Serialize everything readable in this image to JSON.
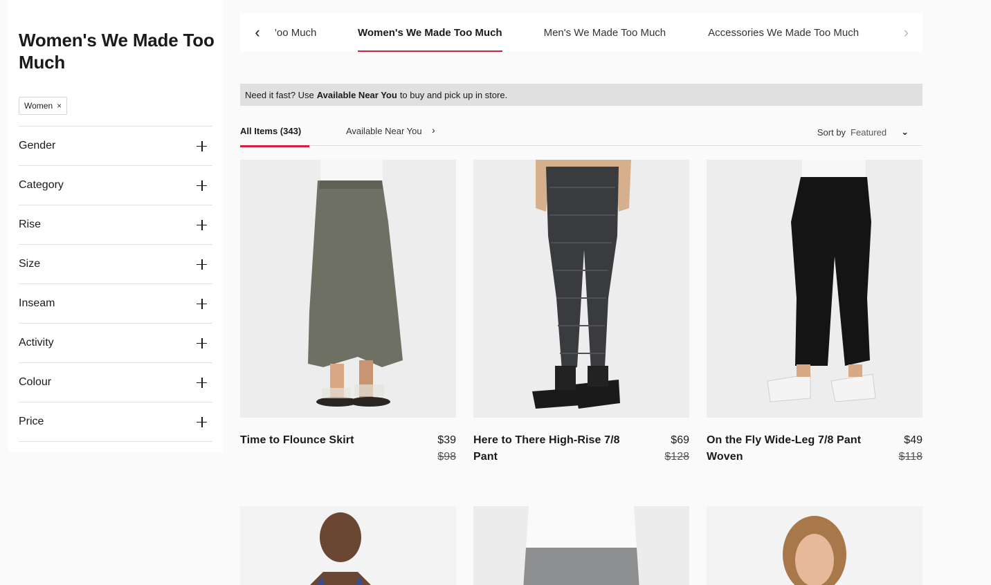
{
  "sidebar": {
    "title": "Women's We Made Too Much",
    "chip": {
      "label": "Women",
      "remove": "×"
    },
    "filters": [
      "Gender",
      "Category",
      "Rise",
      "Size",
      "Inseam",
      "Activity",
      "Colour",
      "Price"
    ]
  },
  "category_tabs": {
    "prev": "‹",
    "next": "›",
    "items": [
      {
        "label": "'oo Much"
      },
      {
        "label": "Women's We Made Too Much",
        "active": true
      },
      {
        "label": "Men's We Made Too Much"
      },
      {
        "label": "Accessories We Made Too Much"
      }
    ]
  },
  "notice": {
    "prefix": "Need it fast? Use",
    "bold": "Available Near You",
    "suffix": "to buy and pick up in store."
  },
  "subtabs": {
    "all": "All Items (343)",
    "near": "Available Near You",
    "sort_label": "Sort by",
    "sort_value": "Featured"
  },
  "products": [
    {
      "name": "Time to Flounce Skirt",
      "price": "$39",
      "was": "$98",
      "image": "olive-skirt-sandals"
    },
    {
      "name": "Here to There High-Rise 7/8 Pant",
      "price": "$69",
      "was": "$128",
      "image": "check-pant-boots"
    },
    {
      "name": "On the Fly Wide-Leg 7/8 Pant Woven",
      "price": "$49",
      "was": "$118",
      "image": "black-wide-pant-sneakers"
    }
  ],
  "colors": {
    "accent": "#d31f3c",
    "background": "#fafafa"
  }
}
